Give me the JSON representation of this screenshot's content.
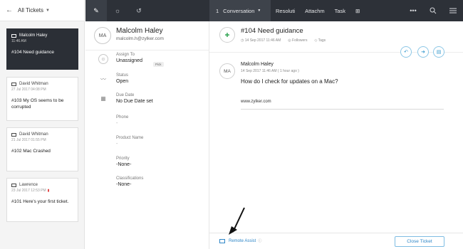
{
  "list": {
    "header": "All Tickets",
    "tickets": [
      {
        "name": "Malcolm Haley",
        "date": "11:46 AM",
        "subject": "#104  Need guidance"
      },
      {
        "name": "David Whitman",
        "date": "27 Jul 2017 04:08 PM",
        "subject": "#103  My OS seems to be corrupted"
      },
      {
        "name": "David Whitman",
        "date": "21 Jul 2017 01:55 PM",
        "subject": "#102  Mac Crashed"
      },
      {
        "name": "Lawrence",
        "date": "23 Jul 2017 12:53 PM",
        "subject": "#101  Here's your first ticket."
      }
    ]
  },
  "topbar": {
    "tabs": {
      "conversation_num": "1",
      "conversation": "Conversation",
      "resolution": "Resoluti",
      "attachments": "Attachm",
      "task": "Task"
    }
  },
  "contact": {
    "initials": "MA",
    "name": "Malcolm Haley",
    "email": "malcolm.h@zylker.com",
    "assign_label": "Assign To",
    "assign_value": "Unassigned",
    "pick": "Pick",
    "status_label": "Status",
    "status_value": "Open",
    "due_label": "Due Date",
    "due_value": "No Due Date set",
    "phone_label": "Phone",
    "phone_value": "-",
    "product_label": "Product Name",
    "product_value": "-",
    "priority_label": "Priority",
    "priority_value": "-None-",
    "class_label": "Classifications",
    "class_value": "-None-"
  },
  "conversation": {
    "title": "#104  Need guidance",
    "date": "14 Sep 2017 11:46 AM",
    "followers": "Followers",
    "tags": "Tags",
    "message": {
      "initials": "MA",
      "author": "Malcolm Haley",
      "date": "14 Sep 2017 11:46 AM ( 1 hour ago )",
      "body": "How do I check for updates on a Mac?",
      "url": "www.zylker.com"
    },
    "footer": {
      "remote_assist": "Remote Assist",
      "close_ticket": "Close Ticket"
    }
  }
}
